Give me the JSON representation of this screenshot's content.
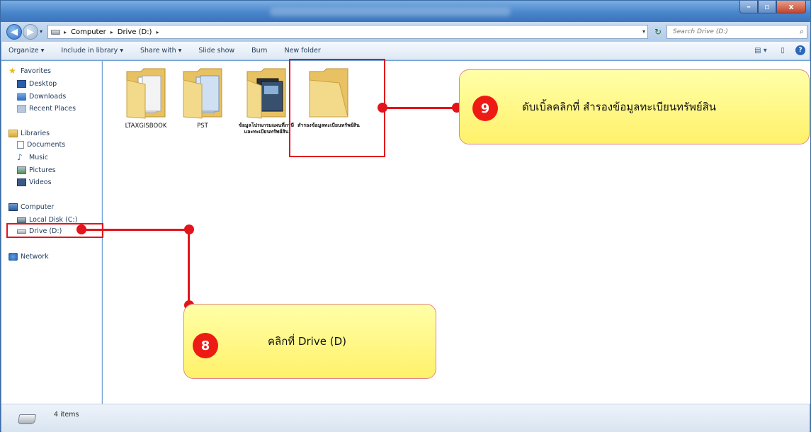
{
  "window": {
    "min_label": "–",
    "max_label": "▫",
    "close_label": "x"
  },
  "address": {
    "back_icon": "◀",
    "forward_icon": "▶",
    "recent_icon": "▾",
    "crumbs": [
      "Computer",
      "Drive (D:)"
    ],
    "separator": "▸",
    "dropdown_icon": "▾",
    "refresh_icon": "↻",
    "search_placeholder": "Search Drive (D:)",
    "search_icon": "⌕"
  },
  "toolbar": {
    "organize": "Organize ▾",
    "include_in_library": "Include in library ▾",
    "share_with": "Share with ▾",
    "slide_show": "Slide show",
    "burn": "Burn",
    "new_folder": "New folder",
    "views_icon": "▤ ▾",
    "preview_icon": "▯",
    "help_icon": "?"
  },
  "nav": {
    "favorites": "Favorites",
    "desktop": "Desktop",
    "downloads": "Downloads",
    "recent_places": "Recent Places",
    "libraries": "Libraries",
    "documents": "Documents",
    "music": "Music",
    "pictures": "Pictures",
    "videos": "Videos",
    "computer": "Computer",
    "local_disk": "Local Disk (C:)",
    "drive_d": "Drive (D:)",
    "network": "Network",
    "star_icon": "★",
    "music_icon": "♪"
  },
  "folders": [
    {
      "name": "LTAXGISBOOK"
    },
    {
      "name": "PST"
    },
    {
      "name": "ข้อมูลโปรแกรมแผนที่ภาษีและทะเบียนทรัพย์สิน"
    },
    {
      "name": "สำรองข้อมูลทะเบียนทรัพย์สิน"
    }
  ],
  "status": {
    "item_count": "4 items"
  },
  "callouts": {
    "step8": {
      "number": "8",
      "text": "คลิกที่   Drive (D)"
    },
    "step9": {
      "number": "9",
      "text": "ดับเบิ้ลคลิกที่  สำรองข้อมูลทะเบียนทรัพย์สิน"
    }
  },
  "colors": {
    "accent_red": "#e3141b",
    "callout_yellow": "#fff16a",
    "folder_yellow": "#f0d27a"
  }
}
